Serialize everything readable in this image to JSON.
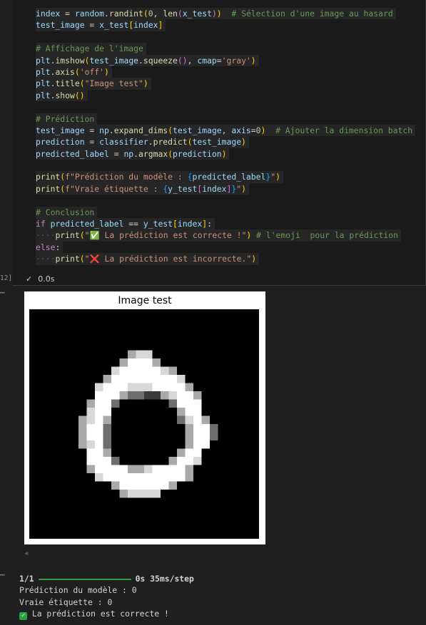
{
  "cell": {
    "execution_count": "12]",
    "status_time": "0.0s",
    "lines": [
      [
        [
          "t-var",
          "index"
        ],
        [
          "t-op",
          " = "
        ],
        [
          "t-var",
          "random"
        ],
        [
          "t-op",
          "."
        ],
        [
          "t-fn",
          "randint"
        ],
        [
          "t-br",
          "("
        ],
        [
          "t-num",
          "0"
        ],
        [
          "t-op",
          ", "
        ],
        [
          "t-fn",
          "len"
        ],
        [
          "t-br2",
          "("
        ],
        [
          "t-var",
          "x_test"
        ],
        [
          "t-br2",
          ")"
        ],
        [
          "t-br",
          ")"
        ],
        [
          "t-op",
          "  "
        ],
        [
          "t-cm",
          "# Sélection d'une image au hasard"
        ]
      ],
      [
        [
          "t-var",
          "test_image"
        ],
        [
          "t-op",
          " = "
        ],
        [
          "t-var",
          "x_test"
        ],
        [
          "t-br",
          "["
        ],
        [
          "t-var",
          "index"
        ],
        [
          "t-br",
          "]"
        ]
      ],
      [],
      [
        [
          "t-cm",
          "# Affichage de l'image"
        ]
      ],
      [
        [
          "t-var",
          "plt"
        ],
        [
          "t-op",
          "."
        ],
        [
          "t-fn",
          "imshow"
        ],
        [
          "t-br",
          "("
        ],
        [
          "t-var",
          "test_image"
        ],
        [
          "t-op",
          "."
        ],
        [
          "t-fn",
          "squeeze"
        ],
        [
          "t-br2",
          "()"
        ],
        [
          "t-op",
          ", "
        ],
        [
          "t-var",
          "cmap"
        ],
        [
          "t-op",
          "="
        ],
        [
          "t-str",
          "'gray'"
        ],
        [
          "t-br",
          ")"
        ]
      ],
      [
        [
          "t-var",
          "plt"
        ],
        [
          "t-op",
          "."
        ],
        [
          "t-fn",
          "axis"
        ],
        [
          "t-br",
          "("
        ],
        [
          "t-str",
          "'off'"
        ],
        [
          "t-br",
          ")"
        ]
      ],
      [
        [
          "t-var",
          "plt"
        ],
        [
          "t-op",
          "."
        ],
        [
          "t-fn",
          "title"
        ],
        [
          "t-br",
          "("
        ],
        [
          "t-str",
          "\"Image test\""
        ],
        [
          "t-br",
          ")"
        ]
      ],
      [
        [
          "t-var",
          "plt"
        ],
        [
          "t-op",
          "."
        ],
        [
          "t-fn",
          "show"
        ],
        [
          "t-br",
          "()"
        ]
      ],
      [],
      [
        [
          "t-cm",
          "# Prédiction"
        ]
      ],
      [
        [
          "t-var",
          "test_image"
        ],
        [
          "t-op",
          " = "
        ],
        [
          "t-var",
          "np"
        ],
        [
          "t-op",
          "."
        ],
        [
          "t-fn",
          "expand_dims"
        ],
        [
          "t-br",
          "("
        ],
        [
          "t-var",
          "test_image"
        ],
        [
          "t-op",
          ", "
        ],
        [
          "t-var",
          "axis"
        ],
        [
          "t-op",
          "="
        ],
        [
          "t-num",
          "0"
        ],
        [
          "t-br",
          ")"
        ],
        [
          "t-op",
          "  "
        ],
        [
          "t-cm",
          "# Ajouter la dimension batch"
        ]
      ],
      [
        [
          "t-var",
          "prediction"
        ],
        [
          "t-op",
          " = "
        ],
        [
          "t-var",
          "classifier"
        ],
        [
          "t-op",
          "."
        ],
        [
          "t-fn",
          "predict"
        ],
        [
          "t-br",
          "("
        ],
        [
          "t-var",
          "test_image"
        ],
        [
          "t-br",
          ")"
        ]
      ],
      [
        [
          "t-var",
          "predicted_label"
        ],
        [
          "t-op",
          " = "
        ],
        [
          "t-var",
          "np"
        ],
        [
          "t-op",
          "."
        ],
        [
          "t-fn",
          "argmax"
        ],
        [
          "t-br",
          "("
        ],
        [
          "t-var",
          "prediction"
        ],
        [
          "t-br",
          ")"
        ]
      ],
      [],
      [
        [
          "t-fn",
          "print"
        ],
        [
          "t-br",
          "("
        ],
        [
          "t-str",
          "f\"Prédiction du modèle : "
        ],
        [
          "t-br3",
          "{"
        ],
        [
          "t-var",
          "predicted_label"
        ],
        [
          "t-br3",
          "}"
        ],
        [
          "t-str",
          "\""
        ],
        [
          "t-br",
          ")"
        ]
      ],
      [
        [
          "t-fn",
          "print"
        ],
        [
          "t-br",
          "("
        ],
        [
          "t-str",
          "f\"Vraie étiquette : "
        ],
        [
          "t-br3",
          "{"
        ],
        [
          "t-var",
          "y_test"
        ],
        [
          "t-br2",
          "["
        ],
        [
          "t-var",
          "index"
        ],
        [
          "t-br2",
          "]"
        ],
        [
          "t-br3",
          "}"
        ],
        [
          "t-str",
          "\""
        ],
        [
          "t-br",
          ")"
        ]
      ],
      [],
      [
        [
          "t-cm",
          "# Conclusion"
        ]
      ],
      [
        [
          "t-kw",
          "if"
        ],
        [
          "t-op",
          " "
        ],
        [
          "t-var",
          "predicted_label"
        ],
        [
          "t-op",
          " == "
        ],
        [
          "t-var",
          "y_test"
        ],
        [
          "t-br",
          "["
        ],
        [
          "t-var",
          "index"
        ],
        [
          "t-br",
          "]"
        ],
        [
          "t-op",
          ":"
        ]
      ],
      [
        [
          "dots",
          "····"
        ],
        [
          "t-fn",
          "print"
        ],
        [
          "t-br",
          "("
        ],
        [
          "t-str",
          "\"✅ La prédiction est correcte !\""
        ],
        [
          "t-br",
          ")"
        ],
        [
          "t-op",
          " "
        ],
        [
          "t-cm",
          "# l'emoji  pour la prédiction"
        ]
      ],
      [
        [
          "t-kw",
          "else"
        ],
        [
          "t-op",
          ":"
        ]
      ],
      [
        [
          "dots",
          "····"
        ],
        [
          "t-fn",
          "print"
        ],
        [
          "t-br",
          "("
        ],
        [
          "t-str",
          "\"❌ La prédiction est incorrecte.\""
        ],
        [
          "t-br",
          ")"
        ]
      ]
    ]
  },
  "figure": {
    "title": "Image test",
    "pixels": [
      "............................",
      "............................",
      "............................",
      "............................",
      "............................",
      "............cdd.............",
      "...........ceeec............",
      "..........deeeeedc..........",
      ".........ceeeeeeeed.........",
      "........deeedddeeeec........",
      "........eeecbbaacdeec.......",
      ".......ceeb......beee.......",
      ".......dee........cee.......",
      "......cdec........bdec......",
      "......ceeb.........ceeb.....",
      "......ceeb.........ceeb.....",
      "......cdeb.........cee......",
      ".......eec........cee.......",
      ".......eeeb......ceed.......",
      ".......ceeeeccdeeeec........",
      "........deeeeeeeeeec........",
      "..........ceeeeeec..........",
      "...........cdddd............",
      "............................",
      "............................",
      "............................",
      "............................",
      "............................"
    ]
  },
  "output": {
    "progress_label": "1/1",
    "progress_fraction": 1.0,
    "progress_time": "0s 35ms/step",
    "line1": "Prédiction du modèle : 0",
    "line2": "Vraie étiquette : 0",
    "line3": " La prédiction est correcte !"
  }
}
